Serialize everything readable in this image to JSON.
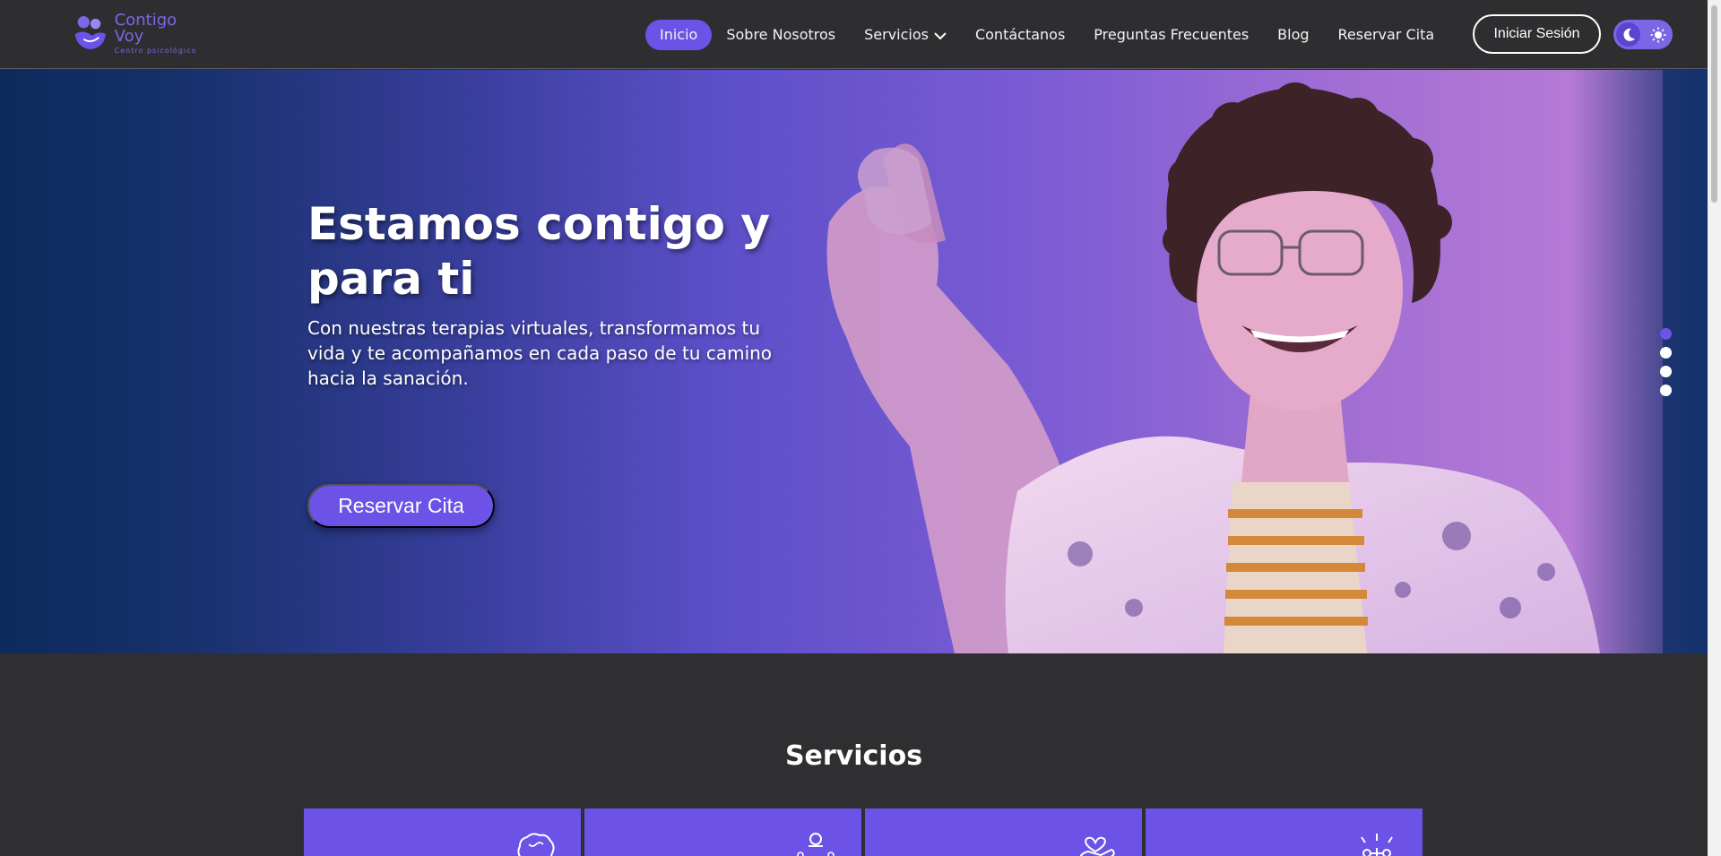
{
  "brand": {
    "title": "Contigo Voy",
    "subtitle": "Centro psicológico",
    "color": "#6c52e6"
  },
  "nav": {
    "items": [
      {
        "label": "Inicio",
        "active": true
      },
      {
        "label": "Sobre Nosotros"
      },
      {
        "label": "Servicios",
        "has_dropdown": true
      },
      {
        "label": "Contáctanos"
      },
      {
        "label": "Preguntas Frecuentes"
      },
      {
        "label": "Blog"
      },
      {
        "label": "Reservar Cita"
      }
    ],
    "login_label": "Iniciar Sesión",
    "theme_icons": [
      "moon-icon",
      "sun-icon"
    ]
  },
  "hero": {
    "title": "Estamos contigo y para ti",
    "text": "Con nuestras terapias virtuales, transformamos tu vida y te acompañamos en cada paso de tu camino hacia la sanación.",
    "button_label": "Reservar Cita",
    "slides": 4,
    "active_slide": 1
  },
  "services": {
    "title": "Servicios",
    "cards": [
      {
        "icon": "brain-icon"
      },
      {
        "icon": "family-icon"
      },
      {
        "icon": "heart-hands-icon"
      },
      {
        "icon": "people-sparkle-icon"
      }
    ]
  }
}
